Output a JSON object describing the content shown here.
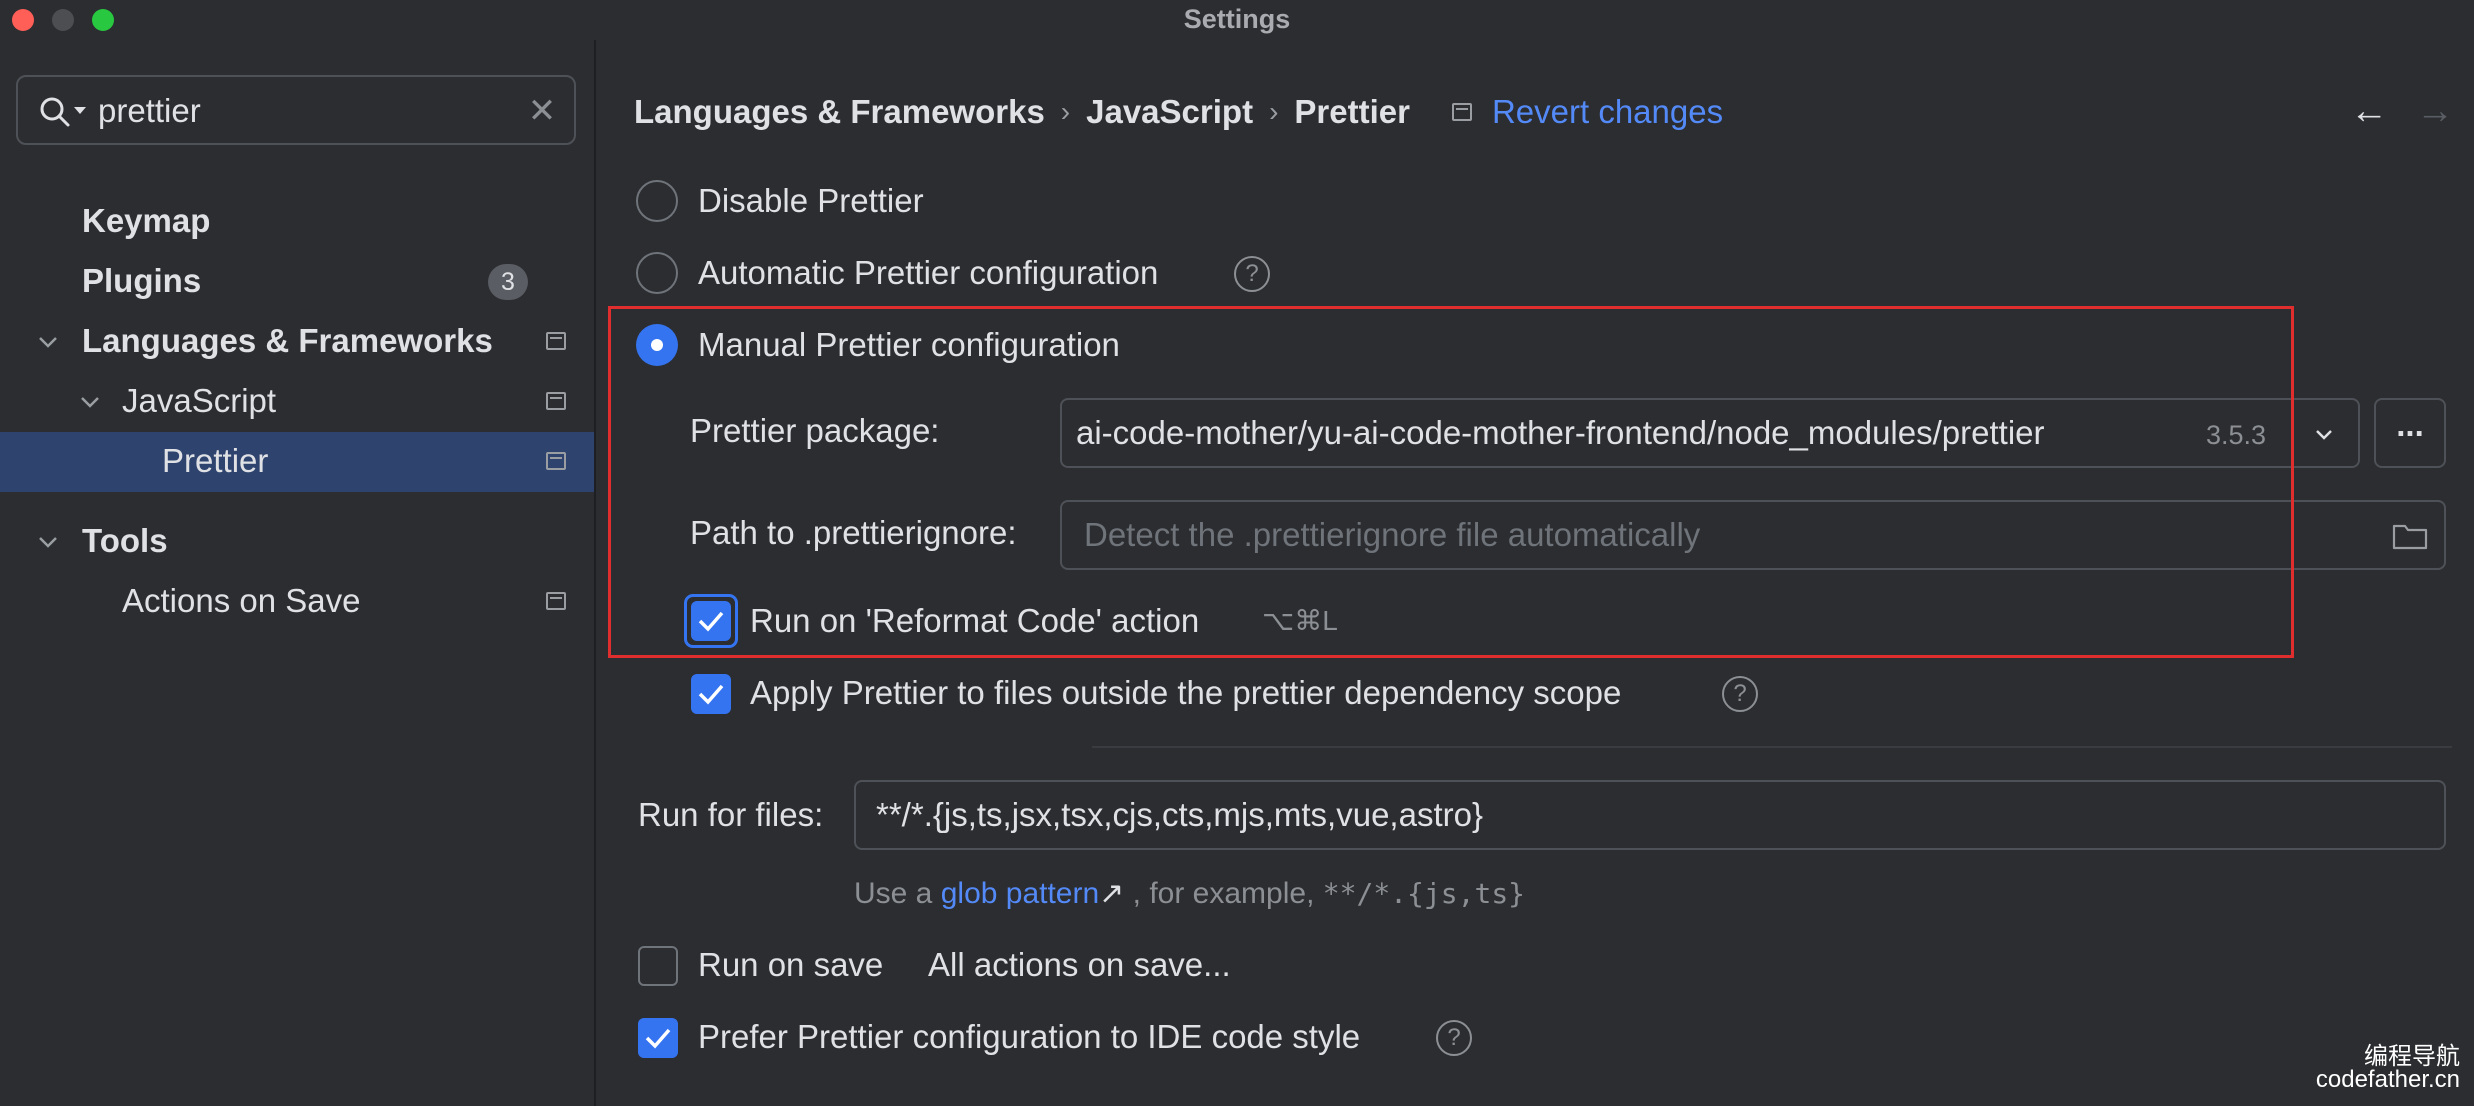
{
  "window": {
    "title": "Settings"
  },
  "search": {
    "value": "prettier",
    "clear_icon": "✕"
  },
  "sidebar": {
    "items": [
      {
        "label": "Keymap"
      },
      {
        "label": "Plugins",
        "badge": "3"
      },
      {
        "label": "Languages & Frameworks"
      },
      {
        "label": "JavaScript"
      },
      {
        "label": "Prettier"
      },
      {
        "label": "Tools"
      },
      {
        "label": "Actions on Save"
      }
    ]
  },
  "breadcrumb": {
    "items": [
      "Languages & Frameworks",
      "JavaScript",
      "Prettier"
    ],
    "separator": "›",
    "revert_label": "Revert changes"
  },
  "nav": {
    "back": "←",
    "forward": "→"
  },
  "options": {
    "disable": "Disable Prettier",
    "automatic": "Automatic Prettier configuration",
    "manual": "Manual Prettier configuration"
  },
  "help_glyph": "?",
  "package": {
    "label": "Prettier package:",
    "value": "ai-code-mother/yu-ai-code-mother-frontend/node_modules/prettier",
    "version": "3.5.3",
    "browse": "..."
  },
  "ignore": {
    "label": "Path to .prettierignore:",
    "placeholder": "Detect the .prettierignore file automatically"
  },
  "reformat": {
    "label": "Run on 'Reformat Code' action",
    "shortcut": "⌥⌘L"
  },
  "apply_outside": {
    "label": "Apply Prettier to files outside the prettier dependency scope"
  },
  "run_for_files": {
    "label": "Run for files:",
    "value": "**/*.{js,ts,jsx,tsx,cjs,cts,mjs,mts,vue,astro}",
    "hint_prefix": "Use a",
    "hint_link": "glob pattern",
    "hint_arrow": "↗",
    "hint_middle": ", for example,",
    "hint_example": "**/*.{js,ts}"
  },
  "run_on_save": {
    "label": "Run on save",
    "link": "All actions on save..."
  },
  "prefer_config": {
    "label": "Prefer Prettier configuration to IDE code style"
  },
  "watermark": {
    "line1": "编程导航",
    "line2": "codefather.cn"
  },
  "colors": {
    "accent": "#3574f0",
    "link": "#548af7",
    "highlight_box": "#e02d2d",
    "selection": "#2e436e"
  }
}
